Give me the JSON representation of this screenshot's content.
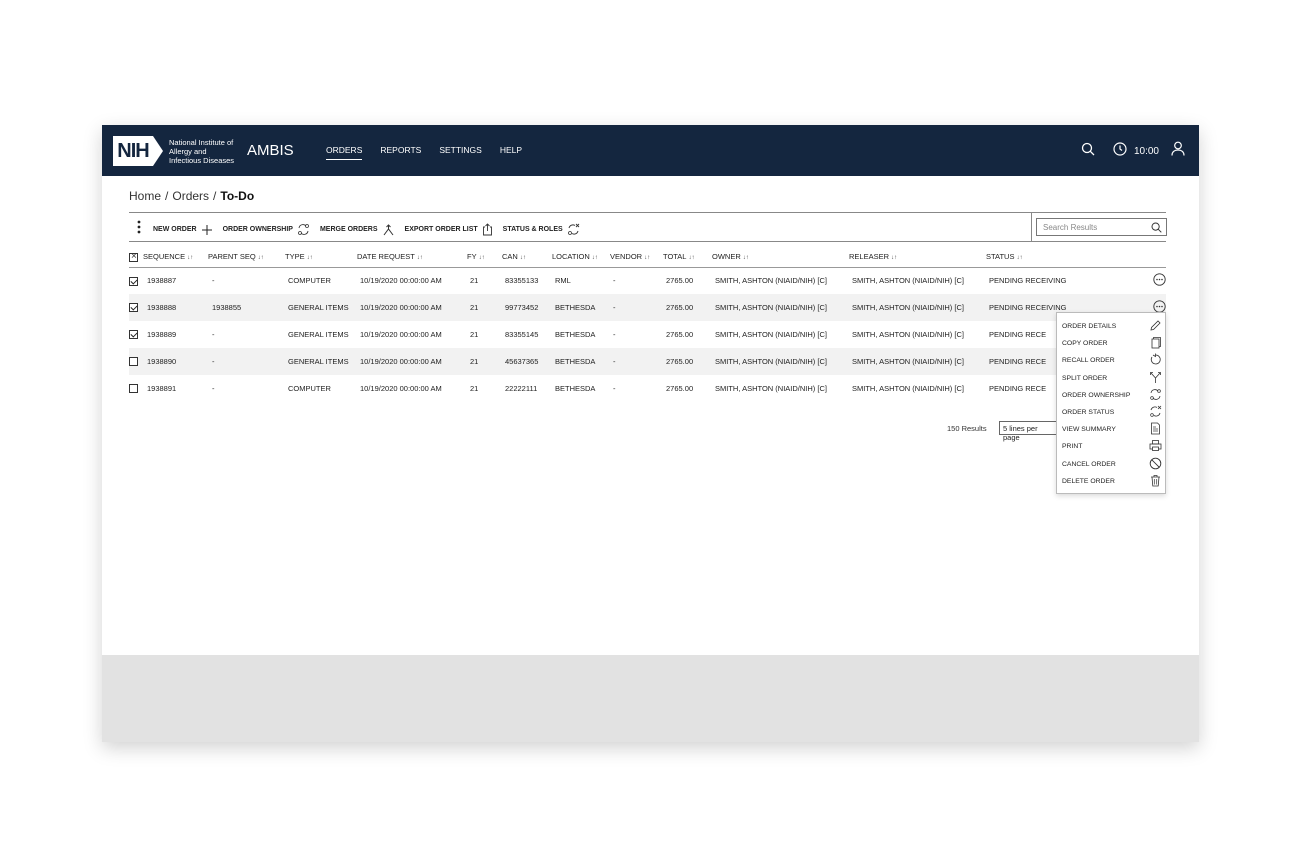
{
  "header": {
    "logo_abbr": "NIH",
    "logo_text_1": "National Institute of",
    "logo_text_2": "Allergy and",
    "logo_text_3": "Infectious Diseases",
    "app_name": "AMBIS",
    "nav": [
      "ORDERS",
      "REPORTS",
      "SETTINGS",
      "HELP"
    ],
    "active_nav": "ORDERS",
    "time": "10:00",
    "icons": [
      "search-icon",
      "clock-icon",
      "user-icon"
    ],
    "bg_color": "#14263f"
  },
  "breadcrumb": {
    "home": "Home",
    "orders": "Orders",
    "current": "To-Do"
  },
  "toolbar": {
    "new_order": "NEW ORDER",
    "order_ownership": "ORDER OWNERSHIP",
    "merge_orders": "MERGE ORDERS",
    "export_order_list": "EXPORT ORDER LIST",
    "status_roles": "STATUS & ROLES",
    "search_placeholder": "Search Results"
  },
  "table": {
    "columns": [
      "SEQUENCE",
      "PARENT SEQ",
      "TYPE",
      "DATE REQUEST",
      "FY",
      "CAN",
      "LOCATION",
      "VENDOR",
      "TOTAL",
      "OWNER",
      "RELEASER",
      "STATUS"
    ],
    "rows": [
      {
        "checked": true,
        "sequence": "1938887",
        "parent_seq": "-",
        "type": "COMPUTER",
        "date_request": "10/19/2020 00:00:00 AM",
        "fy": "21",
        "can": "83355133",
        "location": "RML",
        "vendor": "-",
        "total": "2765.00",
        "owner": "SMITH, ASHTON (NIAID/NIH) [C]",
        "releaser": "SMITH, ASHTON (NIAID/NIH) [C]",
        "status": "PENDING RECEIVING"
      },
      {
        "checked": true,
        "sequence": "1938888",
        "parent_seq": "1938855",
        "type": "GENERAL ITEMS",
        "date_request": "10/19/2020 00:00:00 AM",
        "fy": "21",
        "can": "99773452",
        "location": "BETHESDA",
        "vendor": "-",
        "total": "2765.00",
        "owner": "SMITH, ASHTON (NIAID/NIH) [C]",
        "releaser": "SMITH, ASHTON (NIAID/NIH) [C]",
        "status": "PENDING RECEIVING"
      },
      {
        "checked": true,
        "sequence": "1938889",
        "parent_seq": "-",
        "type": "GENERAL ITEMS",
        "date_request": "10/19/2020 00:00:00 AM",
        "fy": "21",
        "can": "83355145",
        "location": "BETHESDA",
        "vendor": "-",
        "total": "2765.00",
        "owner": "SMITH, ASHTON (NIAID/NIH) [C]",
        "releaser": "SMITH, ASHTON (NIAID/NIH) [C]",
        "status": "PENDING RECE"
      },
      {
        "checked": false,
        "sequence": "1938890",
        "parent_seq": "-",
        "type": "GENERAL ITEMS",
        "date_request": "10/19/2020 00:00:00 AM",
        "fy": "21",
        "can": "45637365",
        "location": "BETHESDA",
        "vendor": "-",
        "total": "2765.00",
        "owner": "SMITH, ASHTON (NIAID/NIH) [C]",
        "releaser": "SMITH, ASHTON (NIAID/NIH) [C]",
        "status": "PENDING RECE"
      },
      {
        "checked": false,
        "sequence": "1938891",
        "parent_seq": "-",
        "type": "COMPUTER",
        "date_request": "10/19/2020 00:00:00 AM",
        "fy": "21",
        "can": "22222111",
        "location": "BETHESDA",
        "vendor": "-",
        "total": "2765.00",
        "owner": "SMITH, ASHTON (NIAID/NIH) [C]",
        "releaser": "SMITH, ASHTON (NIAID/NIH) [C]",
        "status": "PENDING RECE"
      }
    ]
  },
  "pagination": {
    "results": "150 Results",
    "per_page": "5 lines per page"
  },
  "context_menu": {
    "items": [
      {
        "label": "ORDER DETAILS",
        "icon": "pencil-icon"
      },
      {
        "label": "COPY ORDER",
        "icon": "copy-icon"
      },
      {
        "label": "RECALL ORDER",
        "icon": "recall-icon"
      },
      {
        "label": "SPLIT ORDER",
        "icon": "split-icon"
      },
      {
        "label": "ORDER OWNERSHIP",
        "icon": "ownership-icon"
      },
      {
        "label": "ORDER STATUS",
        "icon": "status-icon"
      },
      {
        "label": "VIEW SUMMARY",
        "icon": "pdf-icon"
      },
      {
        "label": "PRINT",
        "icon": "print-icon"
      },
      {
        "label": "CANCEL ORDER",
        "icon": "cancel-icon"
      },
      {
        "label": "DELETE ORDER",
        "icon": "trash-icon"
      }
    ]
  }
}
